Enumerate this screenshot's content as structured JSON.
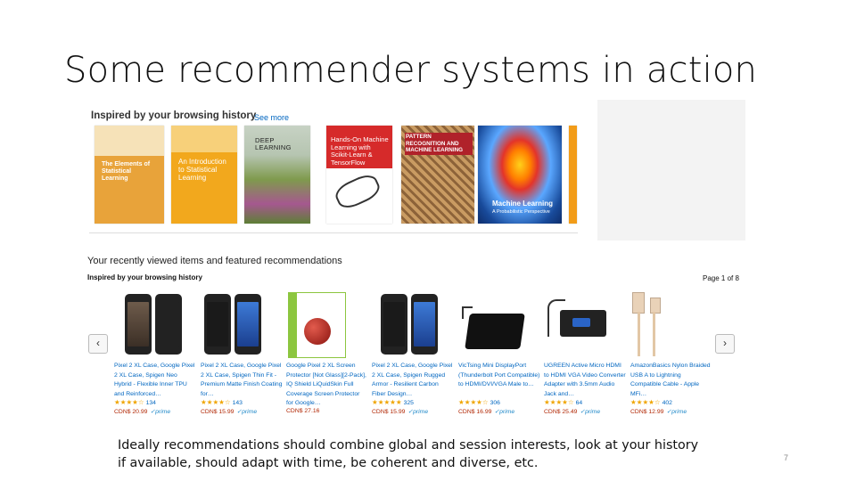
{
  "slide": {
    "title": "Some recommender systems in action",
    "caption_line1": "Ideally recommendations should combine global and session interests, look at your history",
    "caption_line2": "if available, should adapt with time, be coherent and diverse, etc.",
    "number": "7"
  },
  "browsing": {
    "heading": "Inspired by your browsing history",
    "see_more": "See more",
    "books": [
      {
        "title": "The Elements of Statistical Learning",
        "color": "#e8a33a"
      },
      {
        "title": "An Introduction to Statistical Learning",
        "color": "#f2a81d"
      },
      {
        "title": "DEEP LEARNING",
        "color": "#8aa25d"
      },
      {
        "title": "Hands-On Machine Learning with Scikit-Learn & TensorFlow",
        "color": "#d62a2a"
      },
      {
        "title": "PATTERN RECOGNITION AND MACHINE LEARNING",
        "color": "#b8894f"
      },
      {
        "title": "Machine Learning",
        "subtitle": "A Probabilistic Perspective",
        "color": "#2a5fa8"
      }
    ]
  },
  "recent": {
    "heading": "Your recently viewed items and featured recommendations",
    "subheading": "Inspired by your browsing history",
    "page_indicator": "Page 1 of 8",
    "prev_label": "‹",
    "next_label": "›",
    "products": [
      {
        "title": "Pixel 2 XL Case, Google Pixel 2 XL Case, Spigen Neo Hybrid - Flexible Inner TPU and Reinforced…",
        "stars": "★★★★☆",
        "reviews": "134",
        "price": "CDN$ 20.99",
        "prime": "✓prime"
      },
      {
        "title": "Pixel 2 XL Case, Google Pixel 2 XL Case, Spigen Thin Fit - Premium Matte Finish Coating for…",
        "stars": "★★★★☆",
        "reviews": "143",
        "price": "CDN$ 15.99",
        "prime": "✓prime"
      },
      {
        "title": "Google Pixel 2 XL Screen Protector [Not Glass][2-Pack], IQ Shield LiQuidSkin Full Coverage Screen Protector for Google…",
        "stars": "",
        "reviews": "",
        "price": "CDN$ 27.16",
        "prime": ""
      },
      {
        "title": "Pixel 2 XL Case, Google Pixel 2 XL Case, Spigen Rugged Armor - Resilient Carbon Fiber Design…",
        "stars": "★★★★★",
        "reviews": "325",
        "price": "CDN$ 15.99",
        "prime": "✓prime"
      },
      {
        "title": "VicTsing Mini DisplayPort (Thunderbolt Port Compatible) to HDMI/DVI/VGA Male to…",
        "stars": "★★★★☆",
        "reviews": "306",
        "price": "CDN$ 16.99",
        "prime": "✓prime"
      },
      {
        "title": "UGREEN Active Micro HDMI to HDMI VGA Video Converter Adapter with 3.5mm Audio Jack and…",
        "stars": "★★★★☆",
        "reviews": "64",
        "price": "CDN$ 25.49",
        "prime": "✓prime"
      },
      {
        "title": "AmazonBasics Nylon Braided USB A to Lightning Compatible Cable - Apple MFi…",
        "stars": "★★★★☆",
        "reviews": "402",
        "price": "CDN$ 12.99",
        "prime": "✓prime"
      }
    ]
  }
}
